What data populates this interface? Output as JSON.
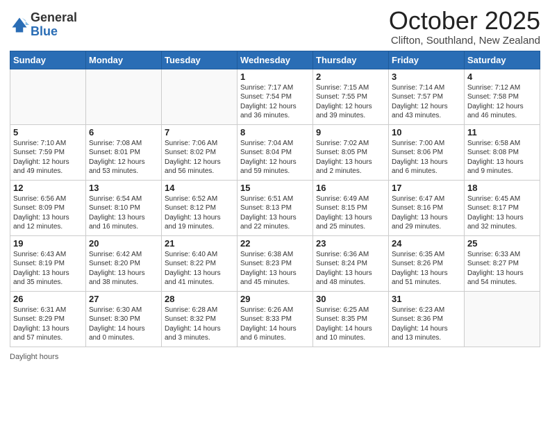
{
  "logo": {
    "general": "General",
    "blue": "Blue"
  },
  "header": {
    "month": "October 2025",
    "location": "Clifton, Southland, New Zealand"
  },
  "weekdays": [
    "Sunday",
    "Monday",
    "Tuesday",
    "Wednesday",
    "Thursday",
    "Friday",
    "Saturday"
  ],
  "weeks": [
    [
      {
        "day": "",
        "info": ""
      },
      {
        "day": "",
        "info": ""
      },
      {
        "day": "",
        "info": ""
      },
      {
        "day": "1",
        "info": "Sunrise: 7:17 AM\nSunset: 7:54 PM\nDaylight: 12 hours and 36 minutes."
      },
      {
        "day": "2",
        "info": "Sunrise: 7:15 AM\nSunset: 7:55 PM\nDaylight: 12 hours and 39 minutes."
      },
      {
        "day": "3",
        "info": "Sunrise: 7:14 AM\nSunset: 7:57 PM\nDaylight: 12 hours and 43 minutes."
      },
      {
        "day": "4",
        "info": "Sunrise: 7:12 AM\nSunset: 7:58 PM\nDaylight: 12 hours and 46 minutes."
      }
    ],
    [
      {
        "day": "5",
        "info": "Sunrise: 7:10 AM\nSunset: 7:59 PM\nDaylight: 12 hours and 49 minutes."
      },
      {
        "day": "6",
        "info": "Sunrise: 7:08 AM\nSunset: 8:01 PM\nDaylight: 12 hours and 53 minutes."
      },
      {
        "day": "7",
        "info": "Sunrise: 7:06 AM\nSunset: 8:02 PM\nDaylight: 12 hours and 56 minutes."
      },
      {
        "day": "8",
        "info": "Sunrise: 7:04 AM\nSunset: 8:04 PM\nDaylight: 12 hours and 59 minutes."
      },
      {
        "day": "9",
        "info": "Sunrise: 7:02 AM\nSunset: 8:05 PM\nDaylight: 13 hours and 2 minutes."
      },
      {
        "day": "10",
        "info": "Sunrise: 7:00 AM\nSunset: 8:06 PM\nDaylight: 13 hours and 6 minutes."
      },
      {
        "day": "11",
        "info": "Sunrise: 6:58 AM\nSunset: 8:08 PM\nDaylight: 13 hours and 9 minutes."
      }
    ],
    [
      {
        "day": "12",
        "info": "Sunrise: 6:56 AM\nSunset: 8:09 PM\nDaylight: 13 hours and 12 minutes."
      },
      {
        "day": "13",
        "info": "Sunrise: 6:54 AM\nSunset: 8:10 PM\nDaylight: 13 hours and 16 minutes."
      },
      {
        "day": "14",
        "info": "Sunrise: 6:52 AM\nSunset: 8:12 PM\nDaylight: 13 hours and 19 minutes."
      },
      {
        "day": "15",
        "info": "Sunrise: 6:51 AM\nSunset: 8:13 PM\nDaylight: 13 hours and 22 minutes."
      },
      {
        "day": "16",
        "info": "Sunrise: 6:49 AM\nSunset: 8:15 PM\nDaylight: 13 hours and 25 minutes."
      },
      {
        "day": "17",
        "info": "Sunrise: 6:47 AM\nSunset: 8:16 PM\nDaylight: 13 hours and 29 minutes."
      },
      {
        "day": "18",
        "info": "Sunrise: 6:45 AM\nSunset: 8:17 PM\nDaylight: 13 hours and 32 minutes."
      }
    ],
    [
      {
        "day": "19",
        "info": "Sunrise: 6:43 AM\nSunset: 8:19 PM\nDaylight: 13 hours and 35 minutes."
      },
      {
        "day": "20",
        "info": "Sunrise: 6:42 AM\nSunset: 8:20 PM\nDaylight: 13 hours and 38 minutes."
      },
      {
        "day": "21",
        "info": "Sunrise: 6:40 AM\nSunset: 8:22 PM\nDaylight: 13 hours and 41 minutes."
      },
      {
        "day": "22",
        "info": "Sunrise: 6:38 AM\nSunset: 8:23 PM\nDaylight: 13 hours and 45 minutes."
      },
      {
        "day": "23",
        "info": "Sunrise: 6:36 AM\nSunset: 8:24 PM\nDaylight: 13 hours and 48 minutes."
      },
      {
        "day": "24",
        "info": "Sunrise: 6:35 AM\nSunset: 8:26 PM\nDaylight: 13 hours and 51 minutes."
      },
      {
        "day": "25",
        "info": "Sunrise: 6:33 AM\nSunset: 8:27 PM\nDaylight: 13 hours and 54 minutes."
      }
    ],
    [
      {
        "day": "26",
        "info": "Sunrise: 6:31 AM\nSunset: 8:29 PM\nDaylight: 13 hours and 57 minutes."
      },
      {
        "day": "27",
        "info": "Sunrise: 6:30 AM\nSunset: 8:30 PM\nDaylight: 14 hours and 0 minutes."
      },
      {
        "day": "28",
        "info": "Sunrise: 6:28 AM\nSunset: 8:32 PM\nDaylight: 14 hours and 3 minutes."
      },
      {
        "day": "29",
        "info": "Sunrise: 6:26 AM\nSunset: 8:33 PM\nDaylight: 14 hours and 6 minutes."
      },
      {
        "day": "30",
        "info": "Sunrise: 6:25 AM\nSunset: 8:35 PM\nDaylight: 14 hours and 10 minutes."
      },
      {
        "day": "31",
        "info": "Sunrise: 6:23 AM\nSunset: 8:36 PM\nDaylight: 14 hours and 13 minutes."
      },
      {
        "day": "",
        "info": ""
      }
    ]
  ],
  "footer": {
    "daylight_label": "Daylight hours"
  }
}
